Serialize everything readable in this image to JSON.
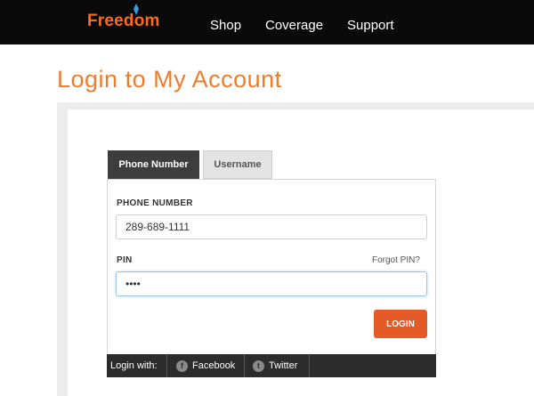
{
  "header": {
    "logo_text": "Freedom",
    "nav": [
      "Shop",
      "Coverage",
      "Support"
    ]
  },
  "page": {
    "title": "Login to My Account"
  },
  "tabs": {
    "phone": "Phone Number",
    "username": "Username"
  },
  "form": {
    "phone_label": "PHONE NUMBER",
    "phone_value": "289-689-1111",
    "pin_label": "PIN",
    "forgot_label": "Forgot PIN?",
    "pin_value": "••••",
    "login_label": "LOGIN"
  },
  "social": {
    "login_with_label": "Login with:",
    "facebook_label": "Facebook",
    "twitter_label": "Twitter"
  },
  "colors": {
    "brand_orange": "#ee7c2b",
    "login_button": "#e45a26",
    "header_bg": "#0a0a0a"
  }
}
